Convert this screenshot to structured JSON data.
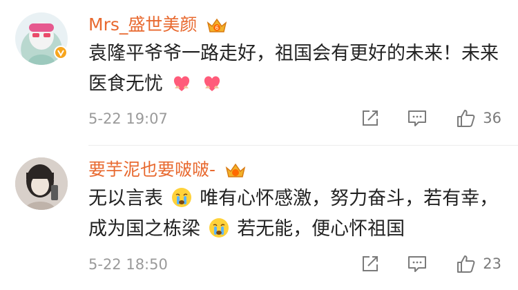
{
  "comments": [
    {
      "username": "Mrs_盛世美颜",
      "text_part1": "袁隆平爷爷一路走好，祖国会有更好的未来！未来医食无忧",
      "text_part2": "",
      "timestamp": "5-22 19:07",
      "likes": "36",
      "verified": true,
      "emoji": [
        "heart-hands-emoji",
        "heart-hands-emoji"
      ]
    },
    {
      "username": "要芋泥也要啵啵-",
      "text_part1": "无以言表",
      "text_part2": "唯有心怀感激，努力奋斗，若有幸，成为国之栋梁",
      "text_part3": "若无能，便心怀祖国",
      "timestamp": "5-22 18:50",
      "likes": "23",
      "verified": false,
      "emoji": [
        "crying-face-emoji",
        "crying-face-emoji"
      ]
    }
  ],
  "icons": {
    "share": "share-icon",
    "reply": "comment-icon",
    "like": "thumbs-up-icon",
    "vip": "crown-icon"
  },
  "colors": {
    "username": "#e8692f",
    "meta": "#9a9a9a",
    "text": "#222222",
    "verified": "#f7a51d"
  }
}
